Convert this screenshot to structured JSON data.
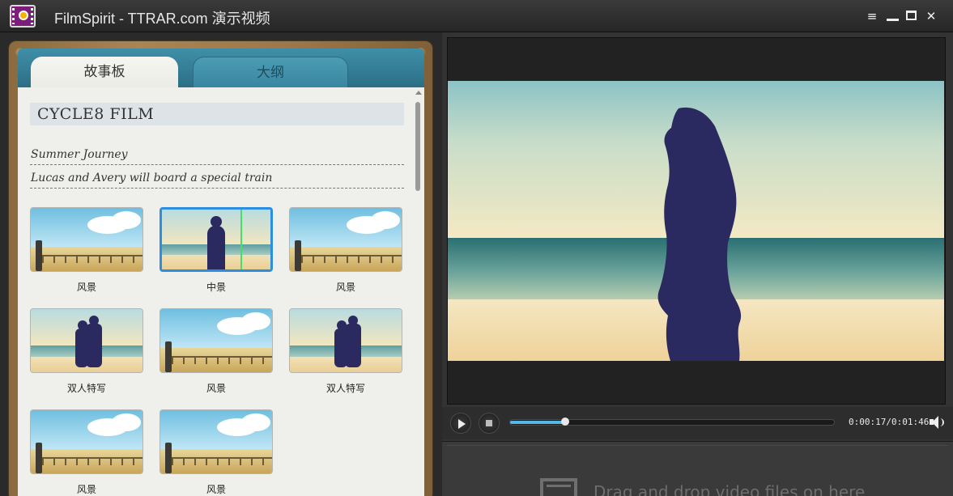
{
  "window": {
    "title": "FilmSpirit - TTRAR.com 演示视频"
  },
  "tabs": [
    {
      "label": "故事板",
      "active": true
    },
    {
      "label": "大纲",
      "active": false
    }
  ],
  "storyboard": {
    "film_title": "CYCLE8 FILM",
    "lines": [
      "Summer Journey",
      "Lucas and Avery will board a special train"
    ],
    "shots": [
      {
        "caption": "风景",
        "scene": "landscape",
        "selected": false
      },
      {
        "caption": "中景",
        "scene": "medium-shot",
        "selected": true
      },
      {
        "caption": "风景",
        "scene": "landscape",
        "selected": false
      },
      {
        "caption": "双人特写",
        "scene": "two-person-closeup",
        "selected": false
      },
      {
        "caption": "风景",
        "scene": "landscape",
        "selected": false
      },
      {
        "caption": "双人特写",
        "scene": "two-person-closeup",
        "selected": false
      },
      {
        "caption": "风景",
        "scene": "landscape",
        "selected": false
      },
      {
        "caption": "风景",
        "scene": "landscape",
        "selected": false
      }
    ]
  },
  "player": {
    "timecode": "0:00:17/0:01:46",
    "progress_fraction": 0.17
  },
  "drop_area": {
    "text": "Drag and drop video files on here"
  },
  "colors": {
    "accent": "#2d8ee0",
    "tab_blue": "#3f8fa8",
    "progress": "#55b7e8",
    "silhouette": "#2b2a60"
  }
}
